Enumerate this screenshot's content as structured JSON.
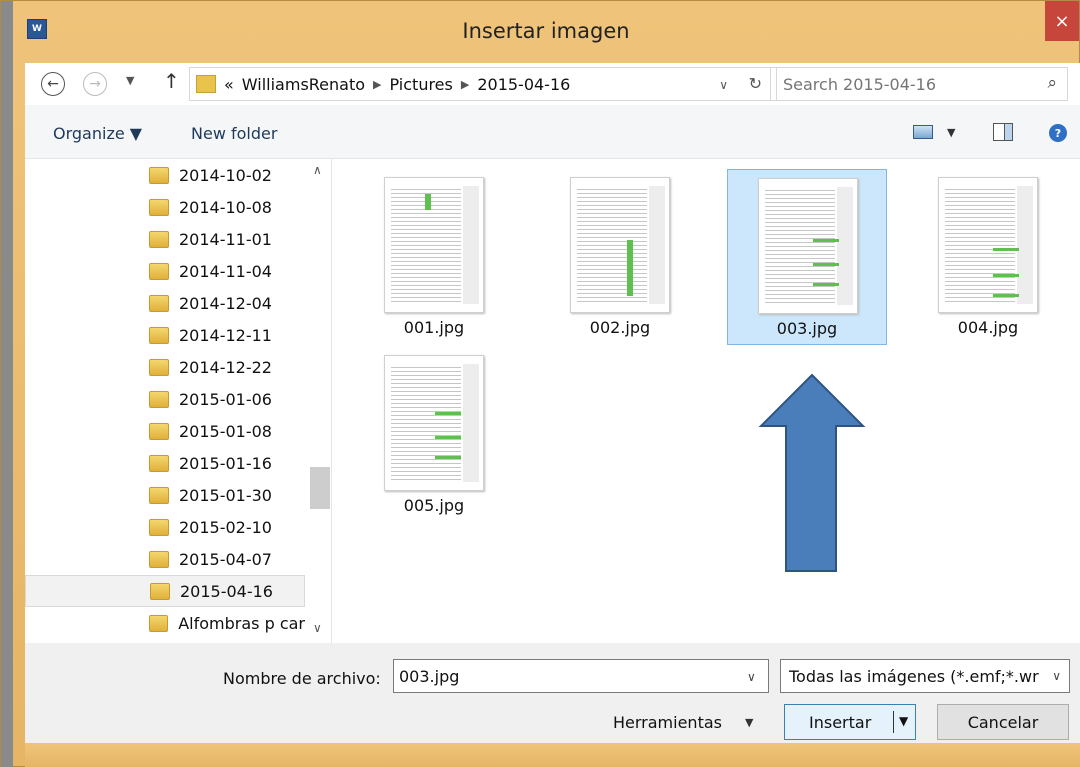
{
  "window": {
    "title": "Insertar imagen",
    "app_icon_text": "W",
    "close_glyph": "×",
    "accent_color": "#e6b566",
    "close_color": "#c7463b"
  },
  "address": {
    "back_glyph": "←",
    "forward_glyph": "→",
    "recent_glyph": "▼",
    "up_glyph": "↑",
    "overflow": "«",
    "crumbs": [
      "WilliamsRenato",
      "Pictures",
      "2015-04-16"
    ],
    "crumb_sep": "▶",
    "dropdown_glyph": "∨",
    "refresh_glyph": "↻",
    "search_placeholder": "Search 2015-04-16",
    "search_glyph": "⌕"
  },
  "toolbar": {
    "organize_label": "Organize ▼",
    "new_folder_label": "New folder",
    "view_drop_glyph": "▼",
    "help_glyph": "?"
  },
  "nav_tree": {
    "items": [
      {
        "label": "2014-10-02"
      },
      {
        "label": "2014-10-08"
      },
      {
        "label": "2014-11-01"
      },
      {
        "label": "2014-11-04"
      },
      {
        "label": "2014-12-04"
      },
      {
        "label": "2014-12-11"
      },
      {
        "label": "2014-12-22"
      },
      {
        "label": "2015-01-06"
      },
      {
        "label": "2015-01-08"
      },
      {
        "label": "2015-01-16"
      },
      {
        "label": "2015-01-30"
      },
      {
        "label": "2015-02-10"
      },
      {
        "label": "2015-04-07"
      },
      {
        "label": "2015-04-16"
      },
      {
        "label": "Alfombras p car"
      }
    ],
    "selected": "2015-04-16",
    "scroll_up_glyph": "∧",
    "scroll_down_glyph": "∨"
  },
  "files": {
    "items": [
      {
        "name": "001.jpg"
      },
      {
        "name": "002.jpg"
      },
      {
        "name": "003.jpg"
      },
      {
        "name": "004.jpg"
      },
      {
        "name": "005.jpg"
      }
    ],
    "selected": "003.jpg"
  },
  "bottom": {
    "filename_label": "Nombre de archivo:",
    "filename_value": "003.jpg",
    "filename_drop_glyph": "∨",
    "filter_value": "Todas las imágenes (*.emf;*.wr",
    "filter_drop_glyph": "∨",
    "tools_label": "Herramientas",
    "tools_drop_glyph": "▼",
    "insert_label": "Insertar",
    "insert_drop_glyph": "▼",
    "cancel_label": "Cancelar"
  }
}
